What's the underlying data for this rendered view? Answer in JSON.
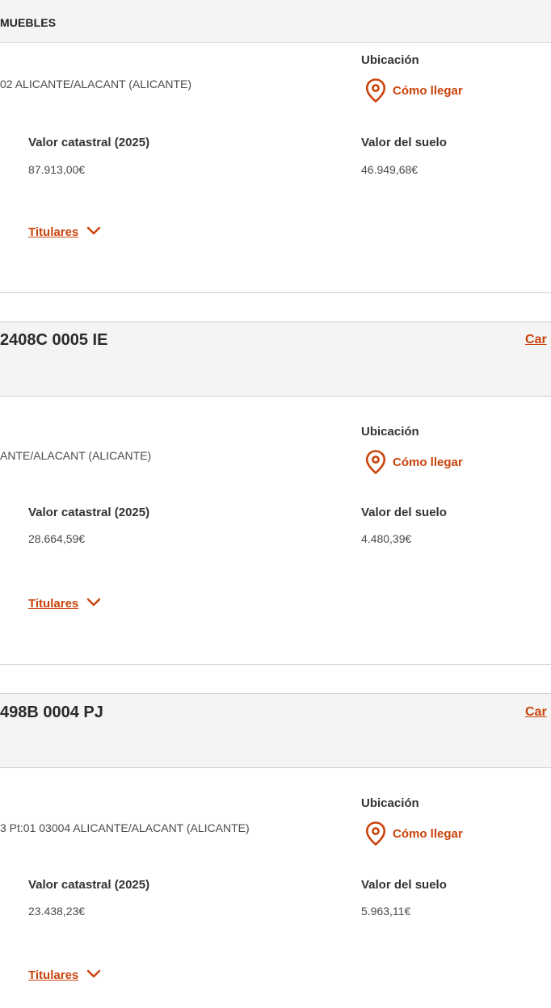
{
  "section": {
    "title": "MUEBLES"
  },
  "ref_link_label": "Car",
  "properties": [
    {
      "address": "02 ALICANTE/ALACANT (ALICANTE)",
      "location_label": "Ubicación",
      "directions_label": "Cómo llegar",
      "cadastral_label": "Valor catastral (2025)",
      "cadastral_value": "87.913,00€",
      "land_label": "Valor del suelo",
      "land_value": "46.949,68€",
      "holders_label": "Titulares"
    },
    {
      "reference": "2408C 0005 IE",
      "address": "ANTE/ALACANT (ALICANTE)",
      "location_label": "Ubicación",
      "directions_label": "Cómo llegar",
      "cadastral_label": "Valor catastral (2025)",
      "cadastral_value": "28.664,59€",
      "land_label": "Valor del suelo",
      "land_value": "4.480,39€",
      "holders_label": "Titulares"
    },
    {
      "reference": "498B 0004 PJ",
      "address": "3 Pt:01 03004 ALICANTE/ALACANT (ALICANTE)",
      "location_label": "Ubicación",
      "directions_label": "Cómo llegar",
      "cadastral_label": "Valor catastral (2025)",
      "cadastral_value": "23.438,23€",
      "land_label": "Valor del suelo",
      "land_value": "5.963,11€",
      "holders_label": "Titulares"
    }
  ],
  "colors": {
    "accent": "#c9430b",
    "header_bg": "#f4f4f4",
    "text": "#333333"
  },
  "icons": {
    "location": "map-pin-icon",
    "expand": "chevron-down-icon"
  }
}
